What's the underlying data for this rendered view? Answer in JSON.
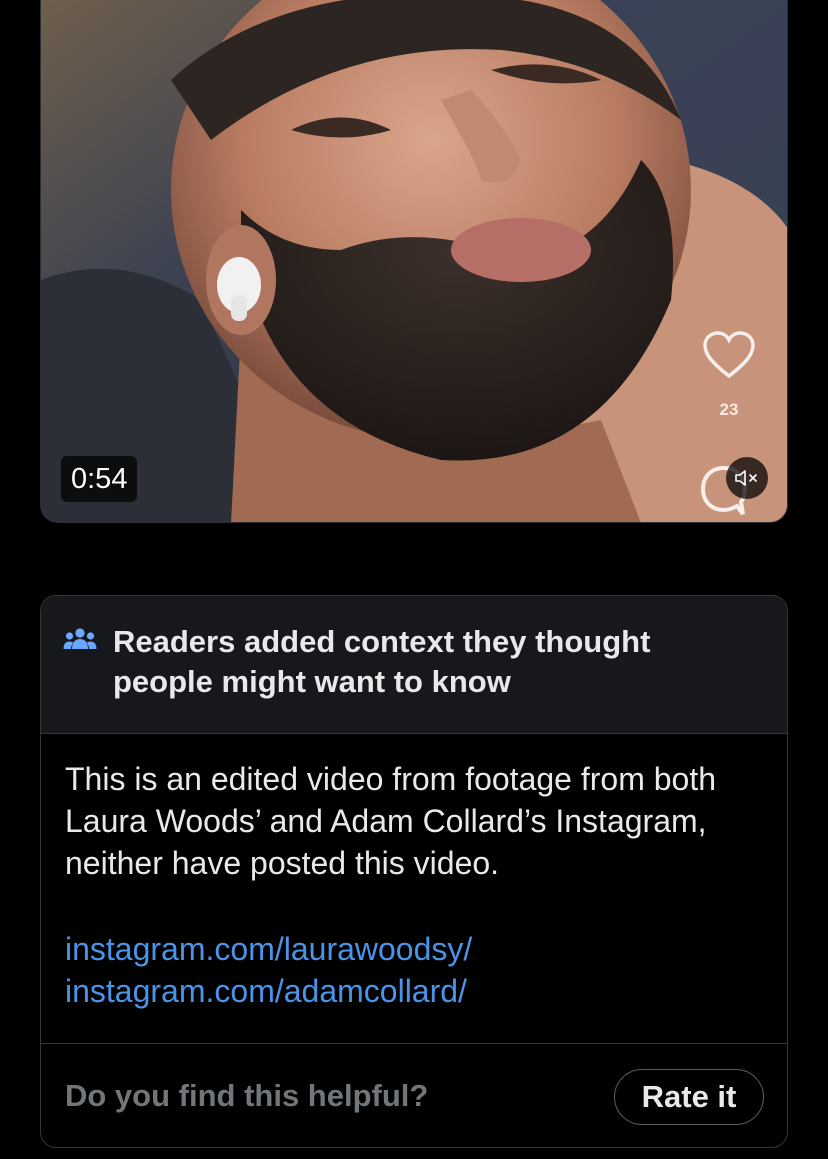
{
  "video": {
    "timestamp": "0:54",
    "overlay_like_count": "23",
    "mute_icon": "speaker-muted-icon",
    "thumbnail": "man-with-beard-and-earbud"
  },
  "community_note": {
    "icon": "people-group-icon",
    "title": "Readers added context they thought people might want to know",
    "body": "This is an edited video from footage from both Laura Woods’ and Adam Collard’s Instagram, neither have posted this video.",
    "links": [
      "instagram.com/laurawoodsy/",
      "instagram.com/adamcollard/"
    ],
    "helpful_question": "Do you find this helpful?",
    "rate_button_label": "Rate it"
  },
  "colors": {
    "background": "#000000",
    "card_header": "#16181c",
    "border": "#33363c",
    "text_primary": "#e7e9ea",
    "text_secondary": "#71767b",
    "link": "#4a94e8",
    "icon_blue": "#6aa9ff"
  }
}
